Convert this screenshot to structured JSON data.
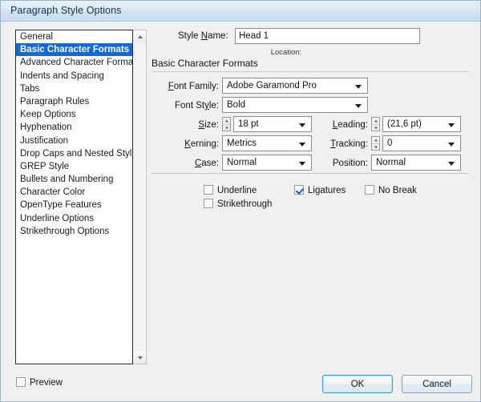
{
  "window": {
    "title": "Paragraph Style Options"
  },
  "sidebar": {
    "items": [
      {
        "label": "General",
        "selected": false
      },
      {
        "label": "Basic Character Formats",
        "selected": true
      },
      {
        "label": "Advanced Character Formats",
        "selected": false
      },
      {
        "label": "Indents and Spacing",
        "selected": false
      },
      {
        "label": "Tabs",
        "selected": false
      },
      {
        "label": "Paragraph Rules",
        "selected": false
      },
      {
        "label": "Keep Options",
        "selected": false
      },
      {
        "label": "Hyphenation",
        "selected": false
      },
      {
        "label": "Justification",
        "selected": false
      },
      {
        "label": "Drop Caps and Nested Styles",
        "selected": false
      },
      {
        "label": "GREP Style",
        "selected": false
      },
      {
        "label": "Bullets and Numbering",
        "selected": false
      },
      {
        "label": "Character Color",
        "selected": false
      },
      {
        "label": "OpenType Features",
        "selected": false
      },
      {
        "label": "Underline Options",
        "selected": false
      },
      {
        "label": "Strikethrough Options",
        "selected": false
      }
    ],
    "scroll_up_icon": "triangle-up-icon",
    "scroll_down_icon": "triangle-down-icon"
  },
  "main": {
    "style_name_label": "Style Name:",
    "style_name_value": "Head 1",
    "location_label": "Location:",
    "section_title": "Basic Character Formats",
    "fields": {
      "font_family": {
        "label": "Font Family:",
        "value": "Adobe Garamond Pro"
      },
      "font_style": {
        "label": "Font Style:",
        "value": "Bold"
      },
      "size": {
        "label": "Size:",
        "value": "18 pt"
      },
      "leading": {
        "label": "Leading:",
        "value": "(21,6 pt)"
      },
      "kerning": {
        "label": "Kerning:",
        "value": "Metrics"
      },
      "tracking": {
        "label": "Tracking:",
        "value": "0"
      },
      "case": {
        "label": "Case:",
        "value": "Normal"
      },
      "position": {
        "label": "Position:",
        "value": "Normal"
      }
    },
    "checkboxes": {
      "underline": {
        "label": "Underline",
        "checked": false
      },
      "ligatures": {
        "label": "Ligatures",
        "checked": true
      },
      "no_break": {
        "label": "No Break",
        "checked": false
      },
      "strikethrough": {
        "label": "Strikethrough",
        "checked": false
      }
    }
  },
  "footer": {
    "preview_label": "Preview",
    "preview_checked": false,
    "ok_label": "OK",
    "cancel_label": "Cancel"
  },
  "colors": {
    "selection_blue": "#1569d6",
    "titlebar_blue": "#c9dcec",
    "dialog_bg": "#f0f0f0",
    "check_blue": "#1a5fbf"
  }
}
